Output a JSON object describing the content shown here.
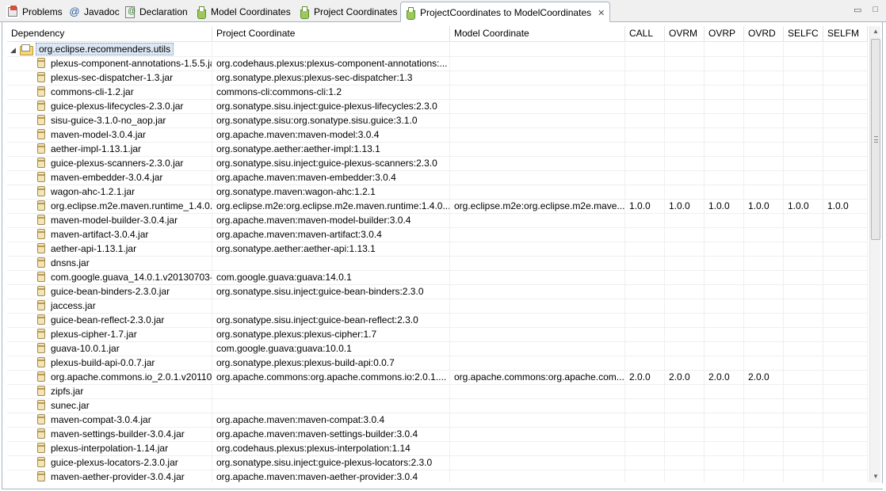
{
  "tabs": [
    {
      "label": "Problems",
      "icon": "problems-icon"
    },
    {
      "label": "Javadoc",
      "icon": "javadoc-icon"
    },
    {
      "label": "Declaration",
      "icon": "declaration-icon"
    },
    {
      "label": "Model Coordinates",
      "icon": "flask-icon"
    },
    {
      "label": "Project Coordinates",
      "icon": "flask-icon"
    },
    {
      "label": "ProjectCoordinates to ModelCoordinates",
      "icon": "flask-icon",
      "active": true
    }
  ],
  "window_buttons": {
    "minimize": "▭",
    "maximize": "□",
    "close_tab": "✕"
  },
  "columns": [
    "Dependency",
    "Project Coordinate",
    "Model Coordinate",
    "CALL",
    "OVRM",
    "OVRP",
    "OVRD",
    "SELFC",
    "SELFM"
  ],
  "root": {
    "label": "org.eclipse.recommenders.utils",
    "expanded_glyph": "◢"
  },
  "rows": [
    [
      "plexus-component-annotations-1.5.5.jar",
      "org.codehaus.plexus:plexus-component-annotations:...",
      "",
      "",
      "",
      "",
      "",
      "",
      ""
    ],
    [
      "plexus-sec-dispatcher-1.3.jar",
      "org.sonatype.plexus:plexus-sec-dispatcher:1.3",
      "",
      "",
      "",
      "",
      "",
      "",
      ""
    ],
    [
      "commons-cli-1.2.jar",
      "commons-cli:commons-cli:1.2",
      "",
      "",
      "",
      "",
      "",
      "",
      ""
    ],
    [
      "guice-plexus-lifecycles-2.3.0.jar",
      "org.sonatype.sisu.inject:guice-plexus-lifecycles:2.3.0",
      "",
      "",
      "",
      "",
      "",
      "",
      ""
    ],
    [
      "sisu-guice-3.1.0-no_aop.jar",
      "org.sonatype.sisu:org.sonatype.sisu.guice:3.1.0",
      "",
      "",
      "",
      "",
      "",
      "",
      ""
    ],
    [
      "maven-model-3.0.4.jar",
      "org.apache.maven:maven-model:3.0.4",
      "",
      "",
      "",
      "",
      "",
      "",
      ""
    ],
    [
      "aether-impl-1.13.1.jar",
      "org.sonatype.aether:aether-impl:1.13.1",
      "",
      "",
      "",
      "",
      "",
      "",
      ""
    ],
    [
      "guice-plexus-scanners-2.3.0.jar",
      "org.sonatype.sisu.inject:guice-plexus-scanners:2.3.0",
      "",
      "",
      "",
      "",
      "",
      "",
      ""
    ],
    [
      "maven-embedder-3.0.4.jar",
      "org.apache.maven:maven-embedder:3.0.4",
      "",
      "",
      "",
      "",
      "",
      "",
      ""
    ],
    [
      "wagon-ahc-1.2.1.jar",
      "org.sonatype.maven:wagon-ahc:1.2.1",
      "",
      "",
      "",
      "",
      "",
      "",
      ""
    ],
    [
      "org.eclipse.m2e.maven.runtime_1.4.0.jar",
      "org.eclipse.m2e:org.eclipse.m2e.maven.runtime:1.4.0....",
      "org.eclipse.m2e:org.eclipse.m2e.mave...",
      "1.0.0",
      "1.0.0",
      "1.0.0",
      "1.0.0",
      "1.0.0",
      "1.0.0"
    ],
    [
      "maven-model-builder-3.0.4.jar",
      "org.apache.maven:maven-model-builder:3.0.4",
      "",
      "",
      "",
      "",
      "",
      "",
      ""
    ],
    [
      "maven-artifact-3.0.4.jar",
      "org.apache.maven:maven-artifact:3.0.4",
      "",
      "",
      "",
      "",
      "",
      "",
      ""
    ],
    [
      "aether-api-1.13.1.jar",
      "org.sonatype.aether:aether-api:1.13.1",
      "",
      "",
      "",
      "",
      "",
      "",
      ""
    ],
    [
      "dnsns.jar",
      "",
      "",
      "",
      "",
      "",
      "",
      "",
      ""
    ],
    [
      "com.google.guava_14.0.1.v20130703-",
      "com.google.guava:guava:14.0.1",
      "",
      "",
      "",
      "",
      "",
      "",
      ""
    ],
    [
      "guice-bean-binders-2.3.0.jar",
      "org.sonatype.sisu.inject:guice-bean-binders:2.3.0",
      "",
      "",
      "",
      "",
      "",
      "",
      ""
    ],
    [
      "jaccess.jar",
      "",
      "",
      "",
      "",
      "",
      "",
      "",
      ""
    ],
    [
      "guice-bean-reflect-2.3.0.jar",
      "org.sonatype.sisu.inject:guice-bean-reflect:2.3.0",
      "",
      "",
      "",
      "",
      "",
      "",
      ""
    ],
    [
      "plexus-cipher-1.7.jar",
      "org.sonatype.plexus:plexus-cipher:1.7",
      "",
      "",
      "",
      "",
      "",
      "",
      ""
    ],
    [
      "guava-10.0.1.jar",
      "com.google.guava:guava:10.0.1",
      "",
      "",
      "",
      "",
      "",
      "",
      ""
    ],
    [
      "plexus-build-api-0.0.7.jar",
      "org.sonatype.plexus:plexus-build-api:0.0.7",
      "",
      "",
      "",
      "",
      "",
      "",
      ""
    ],
    [
      "org.apache.commons.io_2.0.1.v20110",
      "org.apache.commons:org.apache.commons.io:2.0.1....",
      "org.apache.commons:org.apache.com...",
      "2.0.0",
      "2.0.0",
      "2.0.0",
      "2.0.0",
      "",
      ""
    ],
    [
      "zipfs.jar",
      "",
      "",
      "",
      "",
      "",
      "",
      "",
      ""
    ],
    [
      "sunec.jar",
      "",
      "",
      "",
      "",
      "",
      "",
      "",
      ""
    ],
    [
      "maven-compat-3.0.4.jar",
      "org.apache.maven:maven-compat:3.0.4",
      "",
      "",
      "",
      "",
      "",
      "",
      ""
    ],
    [
      "maven-settings-builder-3.0.4.jar",
      "org.apache.maven:maven-settings-builder:3.0.4",
      "",
      "",
      "",
      "",
      "",
      "",
      ""
    ],
    [
      "plexus-interpolation-1.14.jar",
      "org.codehaus.plexus:plexus-interpolation:1.14",
      "",
      "",
      "",
      "",
      "",
      "",
      ""
    ],
    [
      "guice-plexus-locators-2.3.0.jar",
      "org.sonatype.sisu.inject:guice-plexus-locators:2.3.0",
      "",
      "",
      "",
      "",
      "",
      "",
      ""
    ],
    [
      "maven-aether-provider-3.0.4.jar",
      "org.apache.maven:maven-aether-provider:3.0.4",
      "",
      "",
      "",
      "",
      "",
      "",
      ""
    ]
  ],
  "colors": {
    "accent_border": "#a8b4c4",
    "selection": "#dde8f5",
    "jar_icon": "#f3e5b5"
  }
}
